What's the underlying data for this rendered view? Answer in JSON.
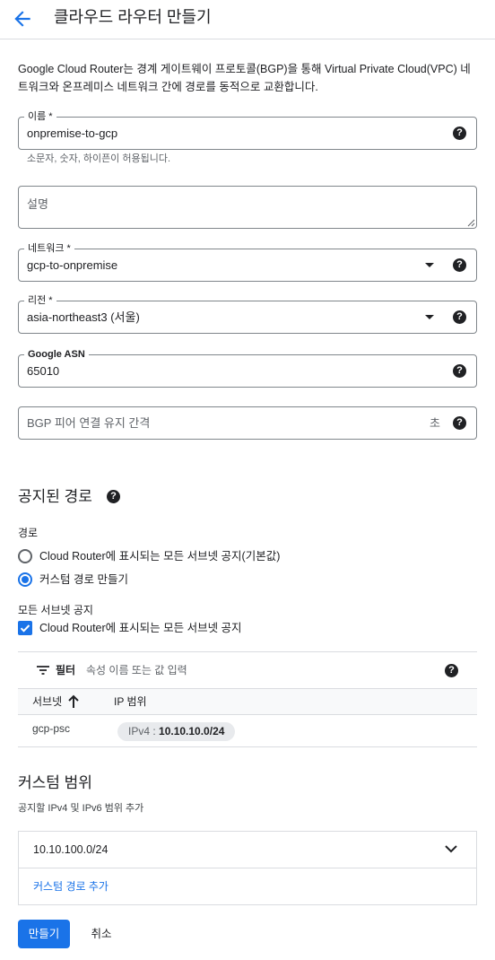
{
  "header": {
    "title": "클라우드 라우터 만들기",
    "back_icon": "arrow-back-icon"
  },
  "intro": "Google Cloud Router는 경계 게이트웨이 프로토콜(BGP)을 통해 Virtual Private Cloud(VPC) 네트워크와 온프레미스 네트워크 간에 경로를 동적으로 교환합니다.",
  "fields": {
    "name": {
      "label": "이름 *",
      "value": "onpremise-to-gcp",
      "hint": "소문자, 숫자, 하이픈이 허용됩니다."
    },
    "description": {
      "placeholder": "설명"
    },
    "network": {
      "label": "네트워크 *",
      "value": "gcp-to-onpremise"
    },
    "region": {
      "label": "리전 *",
      "value": "asia-northeast3 (서울)"
    },
    "asn": {
      "label": "Google ASN",
      "value": "65010"
    },
    "keepalive": {
      "placeholder": "BGP 피어 연결 유지 간격",
      "suffix": "초"
    }
  },
  "advertised": {
    "title": "공지된 경로",
    "routes_label": "경로",
    "options": [
      {
        "label": "Cloud Router에 표시되는 모든 서브넷 공지(기본값)",
        "selected": false
      },
      {
        "label": "커스텀 경로 만들기",
        "selected": true
      }
    ],
    "all_subnets_label": "모든 서브넷 공지",
    "all_subnets_checkbox": "Cloud Router에 표시되는 모든 서브넷 공지",
    "filter": {
      "label": "필터",
      "placeholder": "속성 이름 또는 값 입력"
    },
    "table": {
      "columns": [
        "서브넷",
        "IP 범위"
      ],
      "rows": [
        {
          "subnet": "gcp-psc",
          "ip_prefix": "IPv4 : ",
          "ip_value": "10.10.10.0/24"
        }
      ]
    }
  },
  "custom_ranges": {
    "title": "커스텀 범위",
    "subtitle": "공지할 IPv4 및 IPv6 범위 추가",
    "items": [
      "10.10.100.0/24"
    ],
    "add_link": "커스텀 경로 추가"
  },
  "actions": {
    "create": "만들기",
    "cancel": "취소"
  },
  "colors": {
    "accent": "#1a73e8",
    "border": "#80868b",
    "divider": "#dadce0"
  }
}
